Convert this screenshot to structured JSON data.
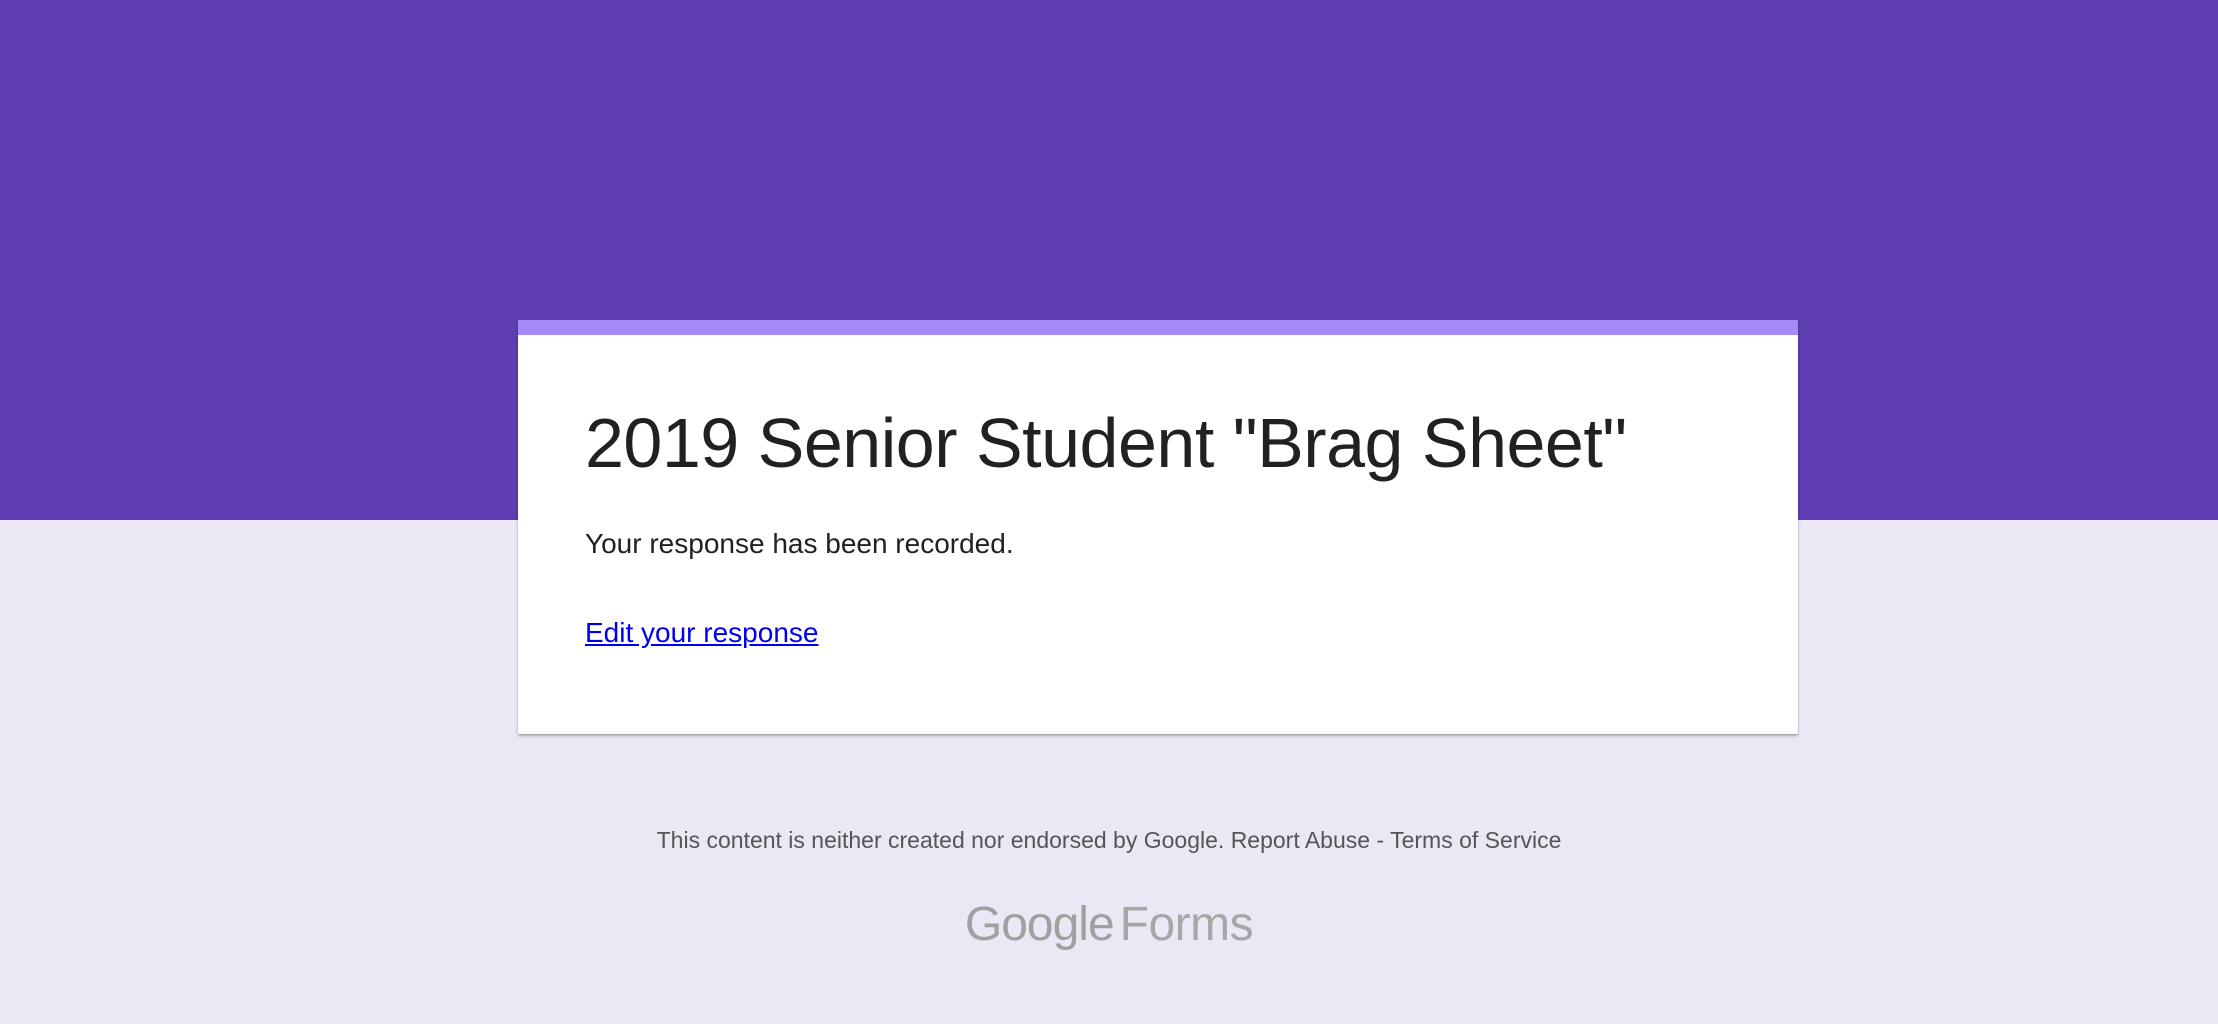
{
  "colors": {
    "header": "#5f3db2",
    "background": "#ebe7f5",
    "card_accent": "#a48af6",
    "link": "#0000ee"
  },
  "form": {
    "title": "2019 Senior Student \"Brag Sheet\"",
    "confirmation": "Your response has been recorded.",
    "edit_link": "Edit your response"
  },
  "footer": {
    "disclaimer": "This content is neither created nor endorsed by Google.",
    "report_abuse": "Report Abuse",
    "separator": "-",
    "terms": "Terms of Service"
  },
  "logo": {
    "brand": "Google",
    "product": "Forms"
  }
}
